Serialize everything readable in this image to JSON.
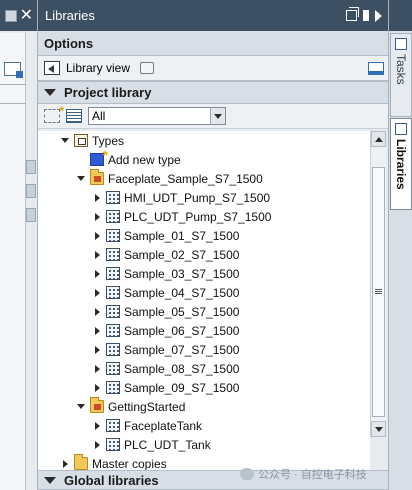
{
  "panel": {
    "title": "Libraries"
  },
  "options": {
    "header": "Options",
    "library_view_label": "Library view"
  },
  "project_library": {
    "header": "Project library",
    "filter": {
      "selected": "All"
    },
    "tree": [
      {
        "label": "Types",
        "expander": "open",
        "icon": "types-folder-icon",
        "indent": 1
      },
      {
        "label": "Add new type",
        "expander": "none",
        "icon": "add-new-type-icon",
        "indent": 2
      },
      {
        "label": "Faceplate_Sample_S7_1500",
        "expander": "open",
        "icon": "type-folder-icon",
        "indent": 2
      },
      {
        "label": "HMI_UDT_Pump_S7_1500",
        "expander": "closed",
        "icon": "type-icon",
        "indent": 3
      },
      {
        "label": "PLC_UDT_Pump_S7_1500",
        "expander": "closed",
        "icon": "type-icon",
        "indent": 3
      },
      {
        "label": "Sample_01_S7_1500",
        "expander": "closed",
        "icon": "type-icon",
        "indent": 3
      },
      {
        "label": "Sample_02_S7_1500",
        "expander": "closed",
        "icon": "type-icon",
        "indent": 3
      },
      {
        "label": "Sample_03_S7_1500",
        "expander": "closed",
        "icon": "type-icon",
        "indent": 3
      },
      {
        "label": "Sample_04_S7_1500",
        "expander": "closed",
        "icon": "type-icon",
        "indent": 3
      },
      {
        "label": "Sample_05_S7_1500",
        "expander": "closed",
        "icon": "type-icon",
        "indent": 3
      },
      {
        "label": "Sample_06_S7_1500",
        "expander": "closed",
        "icon": "type-icon",
        "indent": 3
      },
      {
        "label": "Sample_07_S7_1500",
        "expander": "closed",
        "icon": "type-icon",
        "indent": 3
      },
      {
        "label": "Sample_08_S7_1500",
        "expander": "closed",
        "icon": "type-icon",
        "indent": 3
      },
      {
        "label": "Sample_09_S7_1500",
        "expander": "closed",
        "icon": "type-icon",
        "indent": 3
      },
      {
        "label": "GettingStarted",
        "expander": "open",
        "icon": "type-folder-icon",
        "indent": 2
      },
      {
        "label": "FaceplateTank",
        "expander": "closed",
        "icon": "type-icon",
        "indent": 3
      },
      {
        "label": "PLC_UDT_Tank",
        "expander": "closed",
        "icon": "type-icon",
        "indent": 3
      },
      {
        "label": "Master copies",
        "expander": "closed",
        "icon": "folder-icon",
        "indent": 1
      }
    ]
  },
  "global_libraries": {
    "header": "Global libraries"
  },
  "side_tabs": {
    "tasks": "Tasks",
    "libraries": "Libraries"
  },
  "watermark": {
    "text": "公众号 · 自控电子科技"
  }
}
